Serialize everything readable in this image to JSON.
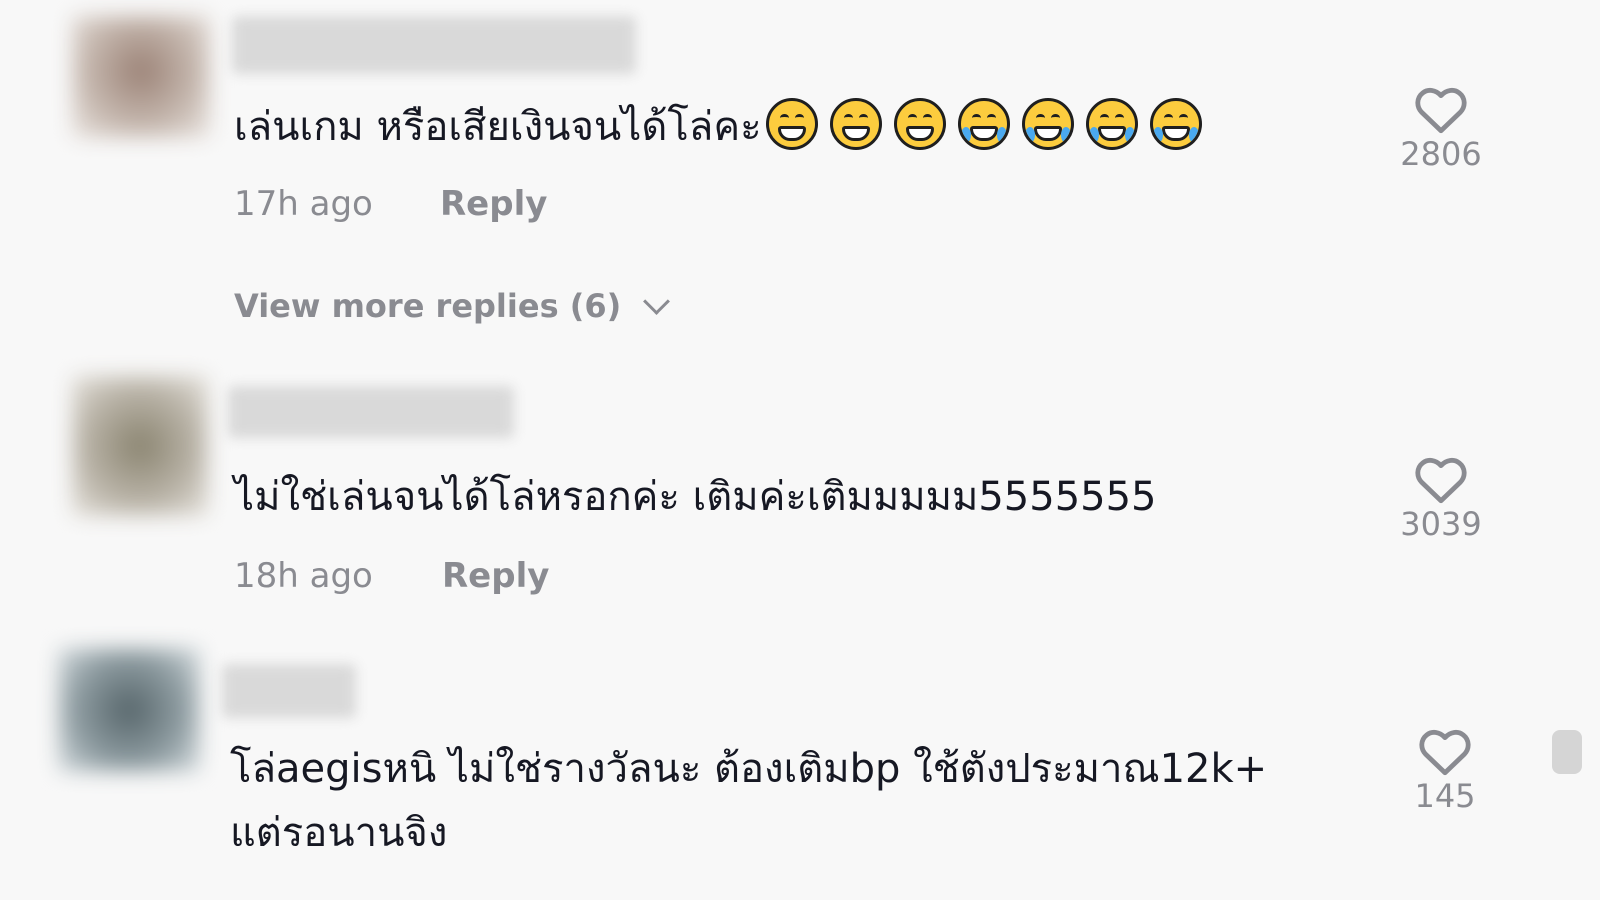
{
  "comments": [
    {
      "text": "เล่นเกม หรือเสียเงินจนได้โล่คะ",
      "emojis": [
        "grin-icon",
        "grin-icon",
        "grin-icon",
        "joy-icon",
        "joy-icon",
        "joy-icon",
        "joy-icon"
      ],
      "time": "17h ago",
      "reply_label": "Reply",
      "likes": "2806",
      "view_more": "View more replies (6)"
    },
    {
      "text": "ไม่ใช่เล่นจนได้โล่หรอกค่ะ เติมค่ะเติมมมมม5555555",
      "time": "18h ago",
      "reply_label": "Reply",
      "likes": "3039"
    },
    {
      "text_line1": "โล่aegisหนิ ไม่ใช่รางวัลนะ ต้องเติมbp ใช้ตังประมาณ12k+",
      "text_line2": "แต่รอนานจิง",
      "likes": "145"
    }
  ],
  "colors": {
    "text": "#161823",
    "meta": "#8a8b91",
    "background": "#f8f8f8"
  }
}
